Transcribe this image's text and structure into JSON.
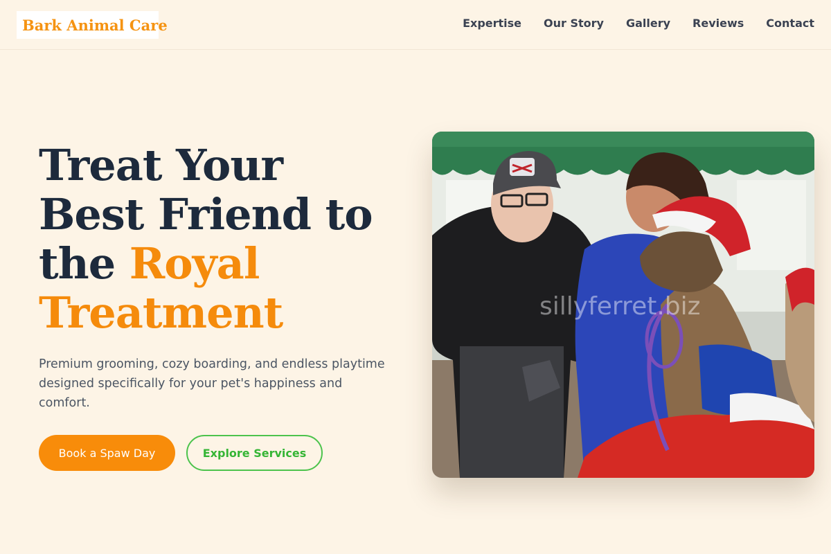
{
  "brand": {
    "name": "Bark Animal Care"
  },
  "nav": {
    "items": [
      {
        "label": "Expertise"
      },
      {
        "label": "Our Story"
      },
      {
        "label": "Gallery"
      },
      {
        "label": "Reviews"
      },
      {
        "label": "Contact"
      }
    ]
  },
  "hero": {
    "title_line1": "Treat Your",
    "title_line2": "Best Friend to",
    "title_line3_plain": "the ",
    "title_line3_accent": "Royal",
    "title_line4_accent": "Treatment",
    "subtitle": "Premium grooming, cozy boarding, and endless playtime designed specifically for your pet's happiness and comfort.",
    "primary_cta": "Book a Spaw Day",
    "secondary_cta": "Explore Services"
  },
  "image": {
    "watermark": "sillyferret.biz"
  },
  "colors": {
    "background": "#fdf4e6",
    "accent_orange": "#f58b0c",
    "accent_green": "#4cc34c",
    "heading_navy": "#1d2a3c"
  }
}
